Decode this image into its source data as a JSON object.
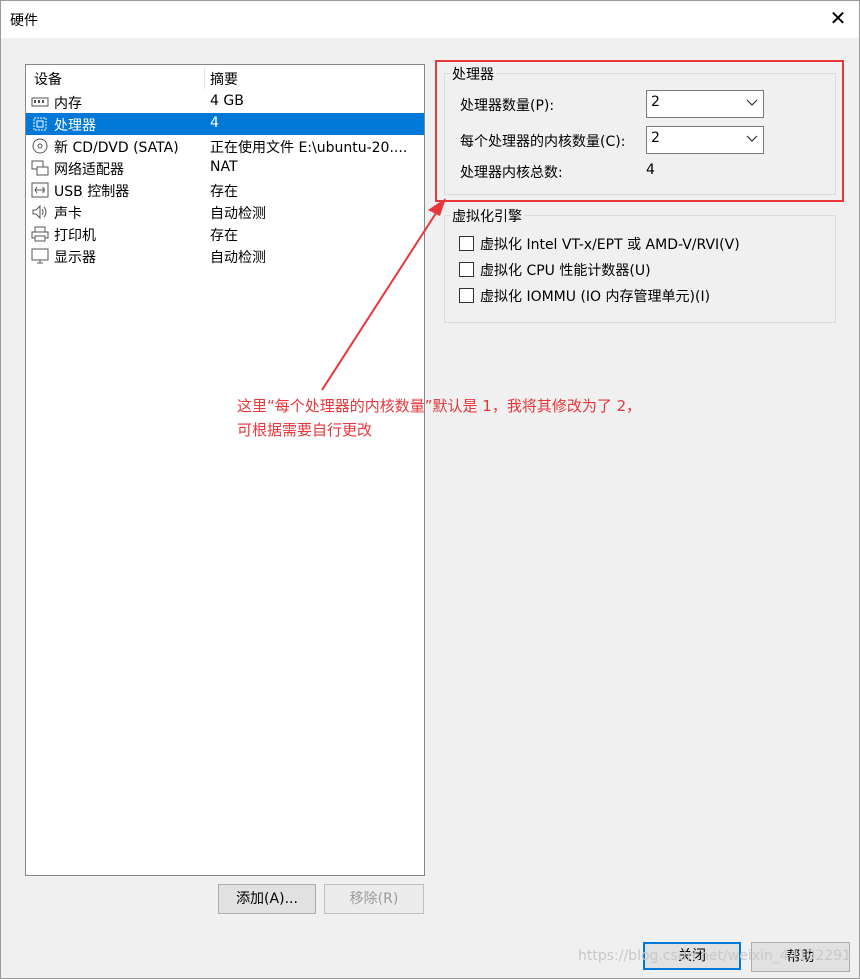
{
  "window": {
    "title": "硬件"
  },
  "device_list": {
    "headers": {
      "device": "设备",
      "summary": "摘要"
    },
    "rows": [
      {
        "icon": "memory-icon",
        "name": "内存",
        "summary": "4 GB",
        "selected": false
      },
      {
        "icon": "processor-icon",
        "name": "处理器",
        "summary": "4",
        "selected": true
      },
      {
        "icon": "cd-dvd-icon",
        "name": "新 CD/DVD (SATA)",
        "summary": "正在使用文件 E:\\ubuntu-20....",
        "selected": false
      },
      {
        "icon": "network-adapter-icon",
        "name": "网络适配器",
        "summary": "NAT",
        "selected": false
      },
      {
        "icon": "usb-icon",
        "name": "USB 控制器",
        "summary": "存在",
        "selected": false
      },
      {
        "icon": "sound-card-icon",
        "name": "声卡",
        "summary": "自动检测",
        "selected": false
      },
      {
        "icon": "printer-icon",
        "name": "打印机",
        "summary": "存在",
        "selected": false
      },
      {
        "icon": "display-icon",
        "name": "显示器",
        "summary": "自动检测",
        "selected": false
      }
    ]
  },
  "buttons": {
    "add": "添加(A)...",
    "remove": "移除(R)",
    "close": "关闭",
    "help": "帮助"
  },
  "processor_group": {
    "title": "处理器",
    "count_label": "处理器数量(P):",
    "count_value": "2",
    "cores_label": "每个处理器的内核数量(C):",
    "cores_value": "2",
    "total_label": "处理器内核总数:",
    "total_value": "4"
  },
  "virtualization_group": {
    "title": "虚拟化引擎",
    "options": [
      {
        "label": "虚拟化 Intel VT-x/EPT 或 AMD-V/RVI(V)",
        "checked": false
      },
      {
        "label": "虚拟化 CPU 性能计数器(U)",
        "checked": false
      },
      {
        "label": "虚拟化 IOMMU (IO 内存管理单元)(I)",
        "checked": false
      }
    ]
  },
  "annotation": {
    "line1": "这里“每个处理器的内核数量”默认是 1，我将其修改为了 2，",
    "line2": "可根据需要自行更改",
    "color": "#e8363a"
  },
  "watermark": "https://blog.csdn.net/weixin_44192291",
  "colors": {
    "selection": "#0078d7",
    "annotation": "#e8363a"
  }
}
